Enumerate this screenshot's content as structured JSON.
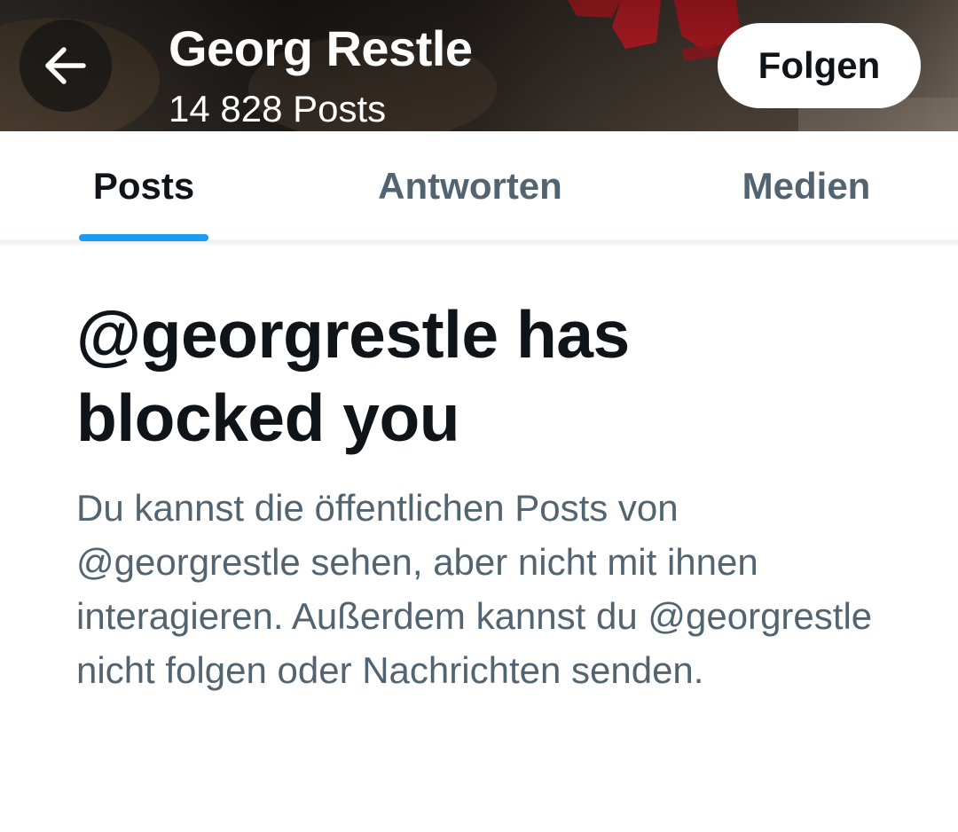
{
  "header": {
    "back_icon": "arrow-left-icon",
    "name": "Georg Restle",
    "post_count": "14 828 Posts",
    "follow_label": "Folgen"
  },
  "tabs": [
    {
      "label": "Posts",
      "active": true
    },
    {
      "label": "Antworten",
      "active": false
    },
    {
      "label": "Medien",
      "active": false
    }
  ],
  "blocked": {
    "title": "@georgrestle has blocked you",
    "description": "Du kannst die öffentlichen Posts von @georgrestle sehen, aber nicht mit ihnen interagieren. Außerdem kannst du @georgrestle nicht folgen oder Nachrichten senden."
  },
  "colors": {
    "accent": "#1d9bf0",
    "text_primary": "#0f1419",
    "text_secondary": "#536471",
    "banner_red": "#d0202a"
  }
}
